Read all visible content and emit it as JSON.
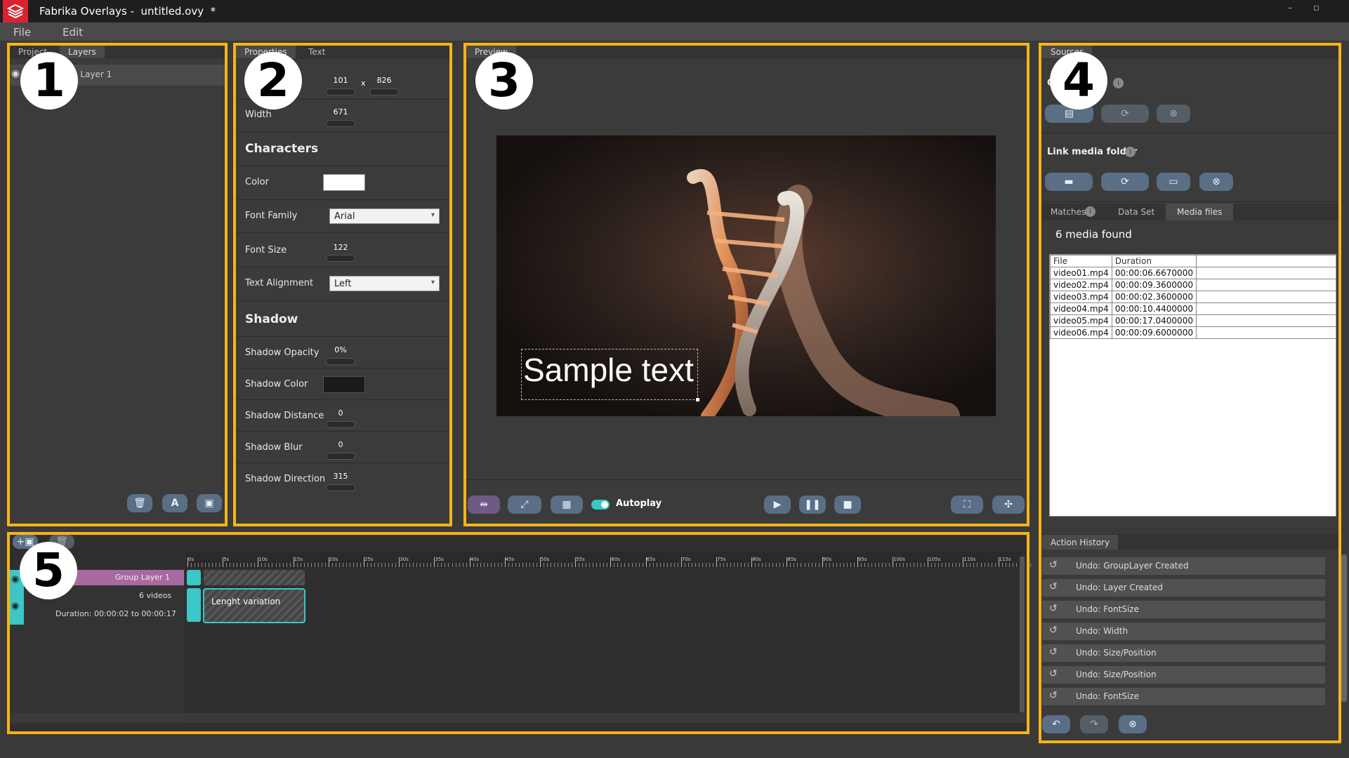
{
  "app": {
    "name": "Fabrika Overlays -",
    "file": "untitled.ovy",
    "modified": "*"
  },
  "window_controls": {
    "minimize": "–",
    "maximize": "▫"
  },
  "menu": [
    "File",
    "Edit"
  ],
  "badges": [
    "1",
    "2",
    "3",
    "4",
    "5"
  ],
  "left_panel": {
    "tabs": [
      "Project",
      "Layers"
    ],
    "active_tab": "Layers",
    "layer_name": "Group Layer 1"
  },
  "properties": {
    "tabs": [
      "Properties",
      "Text"
    ],
    "position": {
      "x": "101",
      "sep": "x",
      "y": "826"
    },
    "width": {
      "label": "Width",
      "value": "671"
    },
    "characters_heading": "Characters",
    "color": {
      "label": "Color",
      "value": "#ffffff"
    },
    "font_family": {
      "label": "Font Family",
      "value": "Arial"
    },
    "font_size": {
      "label": "Font Size",
      "value": "122"
    },
    "text_alignment": {
      "label": "Text Alignment",
      "value": "Left"
    },
    "shadow_heading": "Shadow",
    "shadow_opacity": {
      "label": "Shadow Opacity",
      "value": "0%"
    },
    "shadow_color": {
      "label": "Shadow Color",
      "value": "#1a1a1a"
    },
    "shadow_distance": {
      "label": "Shadow Distance",
      "value": "0"
    },
    "shadow_blur": {
      "label": "Shadow Blur",
      "value": "0"
    },
    "shadow_direction": {
      "label": "Shadow Direction",
      "value": "315"
    }
  },
  "preview": {
    "tab": "Preview",
    "sample_text": "Sample text",
    "autoplay_label": "Autoplay",
    "autoplay_on": true
  },
  "sources": {
    "tab": "Sources",
    "data_source_label": "C...",
    "link_media_label": "Link media folder",
    "subtabs": [
      "Matches",
      "Data Set",
      "Media files"
    ],
    "active_subtab": "Media files",
    "found_text": "6 media found",
    "columns": [
      "File",
      "Duration"
    ],
    "rows": [
      [
        "video01.mp4",
        "00:00:06.6670000"
      ],
      [
        "video02.mp4",
        "00:00:09.3600000"
      ],
      [
        "video03.mp4",
        "00:00:02.3600000"
      ],
      [
        "video04.mp4",
        "00:00:10.4400000"
      ],
      [
        "video05.mp4",
        "00:00:17.0400000"
      ],
      [
        "video06.mp4",
        "00:00:09.6000000"
      ]
    ]
  },
  "history": {
    "tab": "Action History",
    "items": [
      "Undo: GroupLayer Created",
      "Undo: Layer Created",
      "Undo: FontSize",
      "Undo: Width",
      "Undo: Size/Position",
      "Undo: Size/Position",
      "Undo: FontSize"
    ]
  },
  "timeline": {
    "ticks": [
      "0s",
      "5s",
      "10s",
      "15s",
      "20s",
      "25s",
      "30s",
      "35s",
      "40s",
      "45s",
      "50s",
      "55s",
      "60s",
      "65s",
      "70s",
      "75s",
      "80s",
      "85s",
      "90s",
      "95s",
      "100s",
      "105s",
      "110s",
      "115s"
    ],
    "group_label": "Group Layer 1",
    "videos_label": "6 videos",
    "duration_label": "Duration: 00:00:02 to 00:00:17",
    "clip_label": "Lenght variation"
  },
  "colors": {
    "accent": "#f6b418",
    "brand_red": "#d9232e",
    "teal": "#3cc6c6",
    "button_blue": "#5a6e85"
  }
}
